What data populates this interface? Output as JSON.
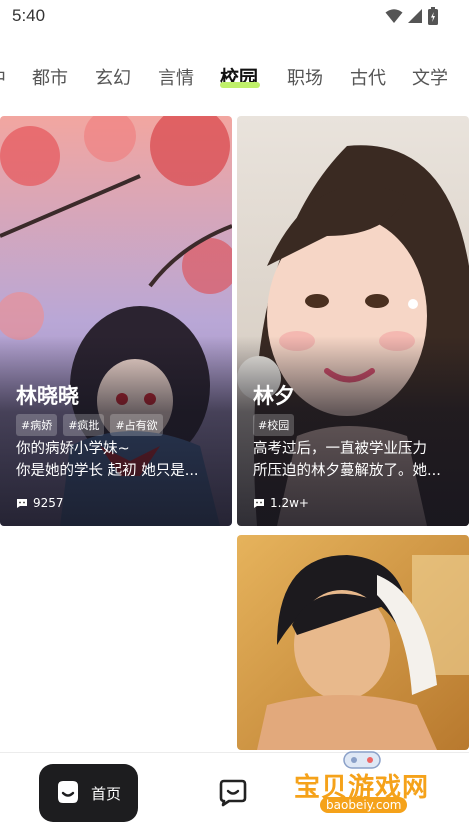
{
  "status_bar": {
    "time": "5:40"
  },
  "tabs": [
    {
      "label": "中",
      "active": false
    },
    {
      "label": "都市",
      "active": false
    },
    {
      "label": "玄幻",
      "active": false
    },
    {
      "label": "言情",
      "active": false
    },
    {
      "label": "校园",
      "active": true
    },
    {
      "label": "职场",
      "active": false
    },
    {
      "label": "古代",
      "active": false
    },
    {
      "label": "文学",
      "active": false
    }
  ],
  "cards": [
    {
      "name": "林晓晓",
      "tags": [
        "#病娇",
        "#疯批",
        "#占有欲"
      ],
      "desc_lines": [
        "你的病娇小学妹~",
        "你是她的学长 起初 她只是..."
      ],
      "count": "9257"
    },
    {
      "name": "林夕",
      "tags": [
        "#校园"
      ],
      "desc_lines": [
        "高考过后，一直被学业压力",
        "所压迫的林夕蔓解放了。她..."
      ],
      "count": "1.2w+"
    }
  ],
  "bottom_nav": {
    "home_label": "首页"
  },
  "watermark": {
    "title": "宝贝游戏网",
    "url": "baobeiy.com"
  },
  "colors": {
    "accent": "#bff06a",
    "nav_dark": "#1d1d1f",
    "watermark": "#f5a21a"
  }
}
